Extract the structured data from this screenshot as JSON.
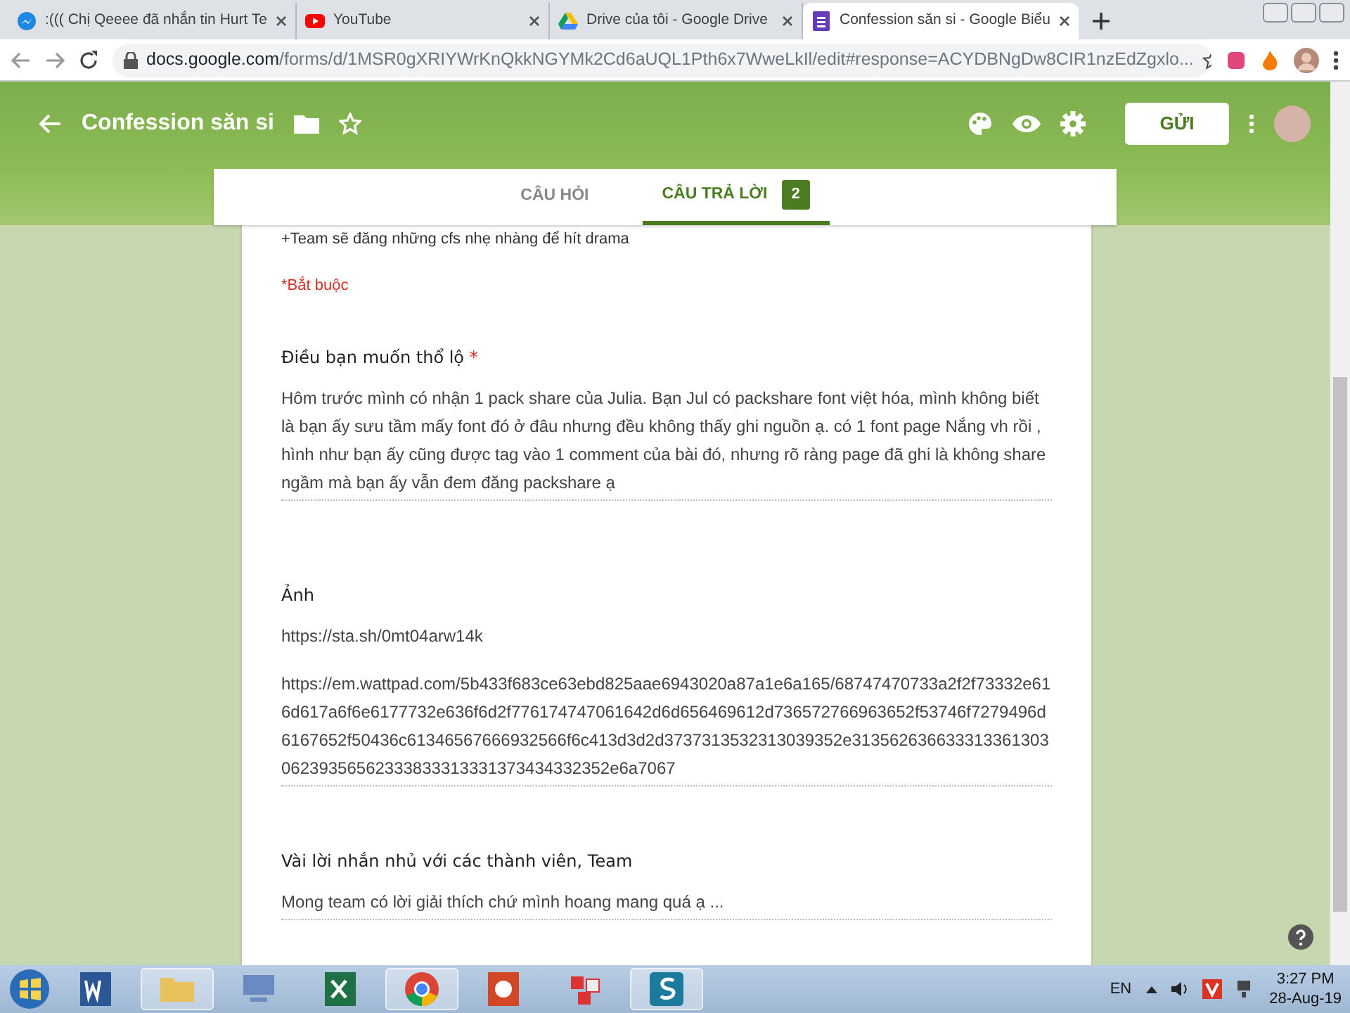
{
  "browser_tabs": [
    {
      "title": ":((( Chị Qeeee đã nhắn tin Hurt Te",
      "selected": false
    },
    {
      "title": "YouTube",
      "selected": false
    },
    {
      "title": "Drive của tôi - Google Drive",
      "selected": false
    },
    {
      "title": "Confession săn si - Google Biểu",
      "selected": true
    }
  ],
  "address_bar": {
    "host": "docs.google.com",
    "path": "/forms/d/1MSR0gXRIYWrKnQkkNGYMk2Cd6aUQL1Pth6x7WweLkIl/edit#response=ACYDBNgDw8CIR1nzEdZgxlo..."
  },
  "form_header": {
    "title": "Confession săn si",
    "send_button": "GỬI"
  },
  "form_tabs": [
    {
      "label": "CÂU HỎI",
      "selected": false
    },
    {
      "label": "CÂU TRẢ LỜI",
      "selected": true,
      "count": "2"
    }
  ],
  "description": "+Team sẽ đăng những cfs nhẹ nhàng để hít drama",
  "required_note": "*Bắt buộc",
  "required_marker": "*",
  "questions": [
    {
      "title": "Điều bạn muốn thổ lộ",
      "required": true,
      "answers": [
        "Hôm trước mình có nhận 1 pack share của Julia. Bạn Jul có packshare font việt hóa, mình không biết là bạn ấy sưu tầm mấy font đó ở đâu nhưng đều không thấy ghi nguồn ạ. có 1 font page Nắng vh rồi , hình như bạn ấy cũng được tag vào 1 comment của bài đó, nhưng rõ ràng page đã ghi là không share ngầm mà bạn ấy vẫn đem đăng packshare ạ"
      ]
    },
    {
      "title": "Ảnh",
      "required": false,
      "answers": [
        "https://sta.sh/0mt04arw14k",
        "https://em.wattpad.com/5b433f683ce63ebd825aae6943020a87a1e6a165/68747470733a2f2f73332e616d617a6f6e6177732e636f6d2f776174747061642d6d656469612d736572766963652f53746f7279496d6167652f50436c61346567666932566f6c413d3d2d3737313532313039352e31356263663331336130306239356562333833313331373434332352e6a7067"
      ]
    },
    {
      "title": "Vài lời nhắn nhủ với các thành viên, Team",
      "required": false,
      "answers": [
        "Mong team có lời giải thích chứ mình hoang mang quá ạ ..."
      ]
    }
  ],
  "taskbar": [
    {
      "selected": false
    },
    {
      "selected": true
    },
    {
      "selected": false
    },
    {
      "selected": false
    },
    {
      "selected": true
    },
    {
      "selected": false
    },
    {
      "selected": false
    },
    {
      "selected": true
    }
  ],
  "tray": {
    "language": "EN",
    "time": "3:27 PM",
    "date": "28-Aug-19"
  }
}
